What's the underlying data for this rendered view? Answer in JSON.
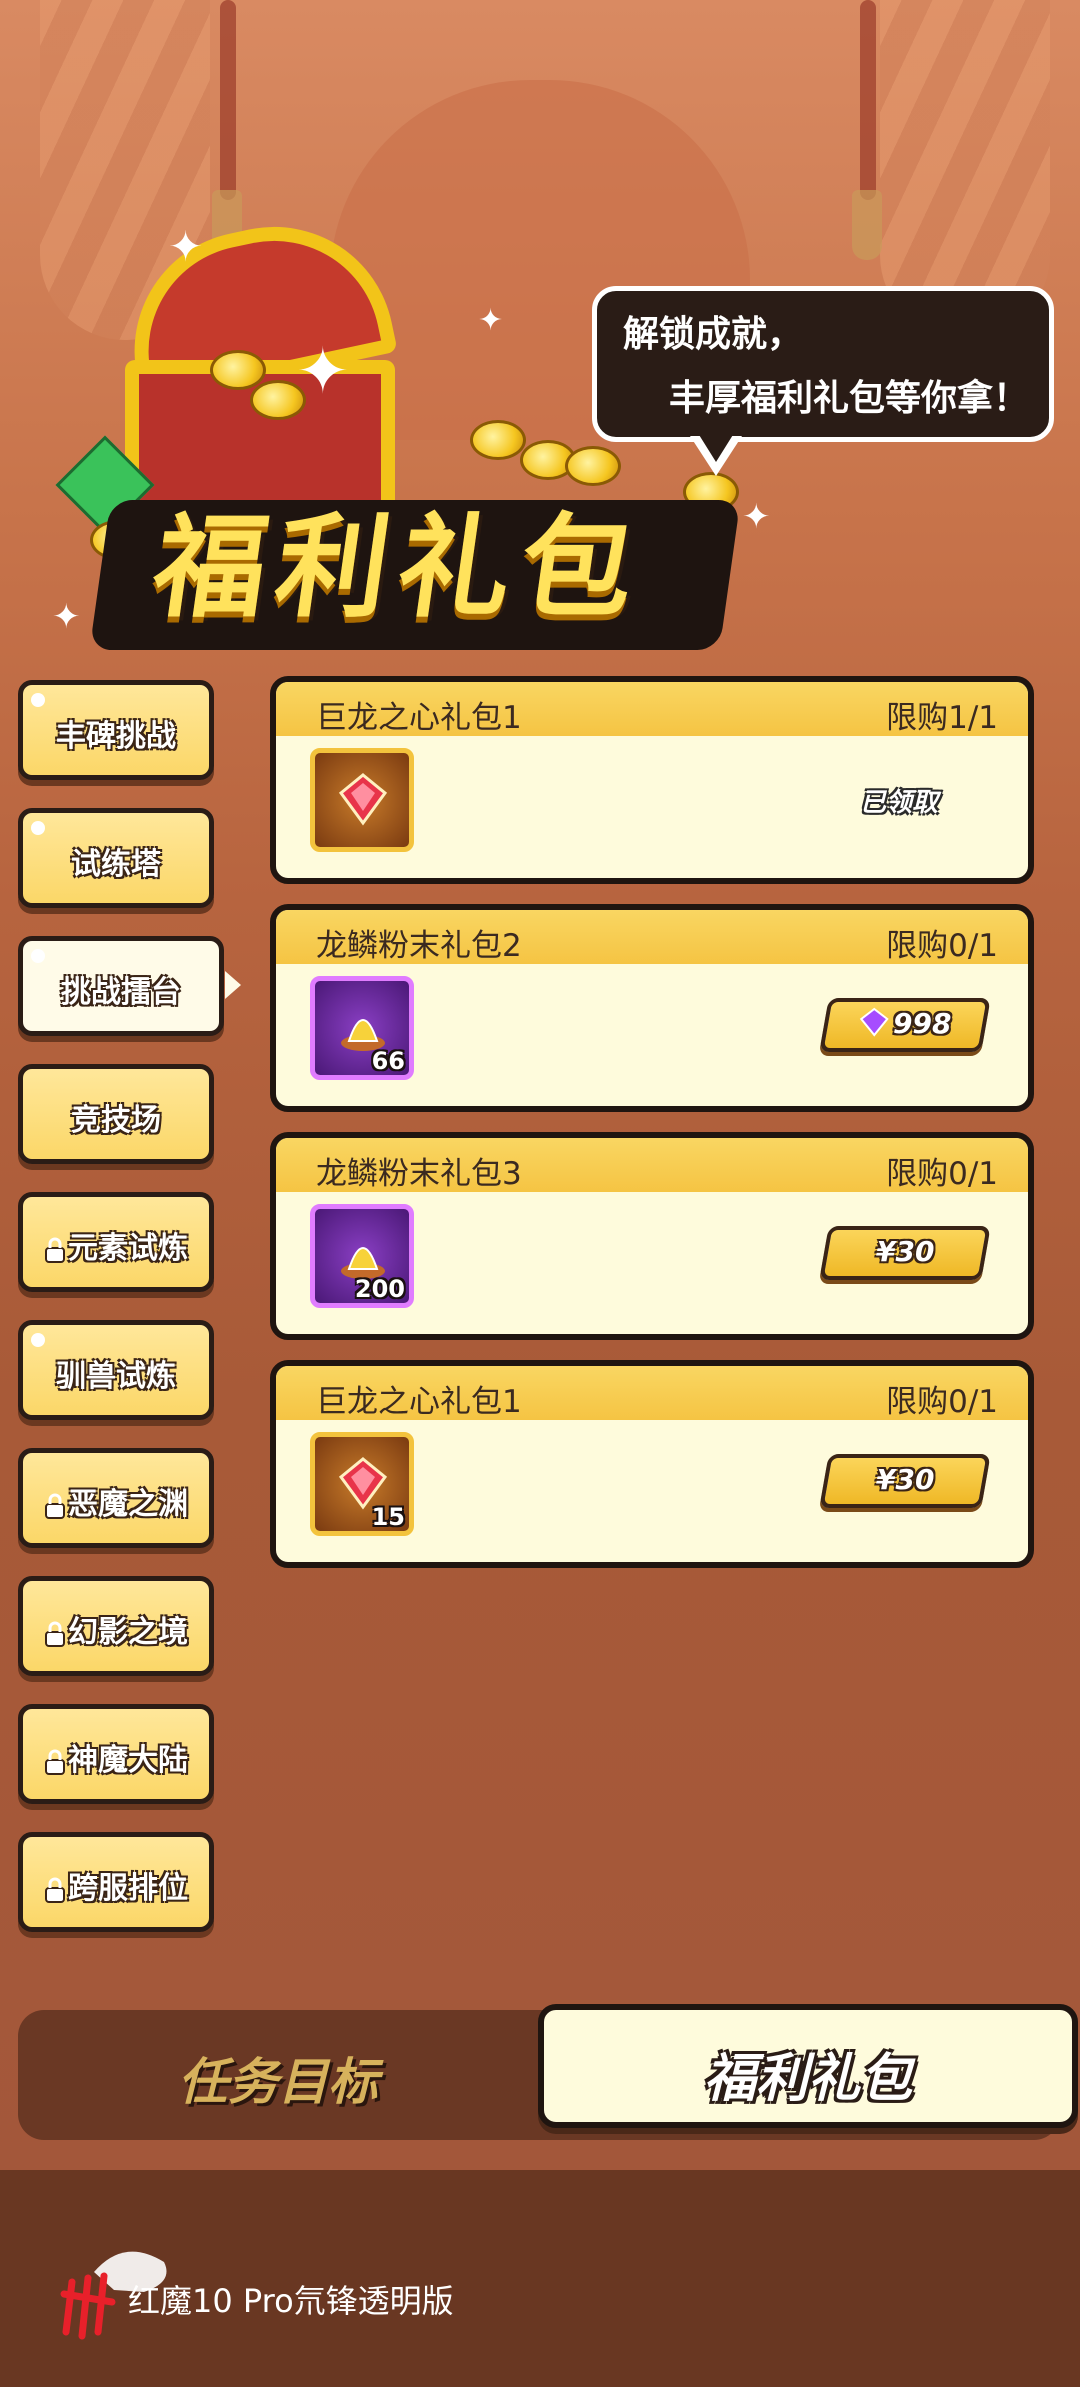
{
  "banner": {
    "title": "福利礼包",
    "bubble_line1": "解锁成就，",
    "bubble_line2": "丰厚福利礼包等你拿！"
  },
  "side_nav": {
    "items": [
      {
        "label": "丰碑挑战",
        "locked": false,
        "active": false,
        "icon": "dot"
      },
      {
        "label": "试练塔",
        "locked": false,
        "active": false,
        "icon": "dot"
      },
      {
        "label": "挑战擂台",
        "locked": false,
        "active": true,
        "icon": "dot"
      },
      {
        "label": "竞技场",
        "locked": false,
        "active": false,
        "icon": "none"
      },
      {
        "label": "元素试炼",
        "locked": true,
        "active": false,
        "icon": "lock-icon"
      },
      {
        "label": "驯兽试炼",
        "locked": false,
        "active": false,
        "icon": "dot"
      },
      {
        "label": "恶魔之渊",
        "locked": true,
        "active": false,
        "icon": "lock-icon"
      },
      {
        "label": "幻影之境",
        "locked": true,
        "active": false,
        "icon": "lock-icon"
      },
      {
        "label": "神魔大陆",
        "locked": true,
        "active": false,
        "icon": "lock-icon"
      },
      {
        "label": "跨服排位",
        "locked": true,
        "active": false,
        "icon": "lock-icon"
      }
    ]
  },
  "packs": [
    {
      "name": "巨龙之心礼包1",
      "limit": "限购1/1",
      "item_icon": "dragon-heart-gem-icon",
      "qty": "",
      "status": "已领取",
      "price": ""
    },
    {
      "name": "龙鳞粉末礼包2",
      "limit": "限购0/1",
      "item_icon": "dragon-scale-powder-icon",
      "qty": "66",
      "status": "",
      "price": "998",
      "price_icon": "purple-gem-icon"
    },
    {
      "name": "龙鳞粉末礼包3",
      "limit": "限购0/1",
      "item_icon": "dragon-scale-powder-icon",
      "qty": "200",
      "status": "",
      "price": "¥30"
    },
    {
      "name": "巨龙之心礼包1",
      "limit": "限购0/1",
      "item_icon": "dragon-heart-gem-icon",
      "qty": "15",
      "status": "",
      "price": "¥30"
    }
  ],
  "tabs": {
    "task_label": "任务目标",
    "gift_label": "福利礼包",
    "active": "gift"
  },
  "footer": {
    "brand_label": "红魔10 Pro氘锋透明版",
    "logo_icon": "red-magic-logo-icon"
  },
  "colors": {
    "accent_yellow": "#f5c443",
    "card_bg": "#fefbdc",
    "outline": "#1f1510",
    "page_bg": "#a85a38"
  }
}
